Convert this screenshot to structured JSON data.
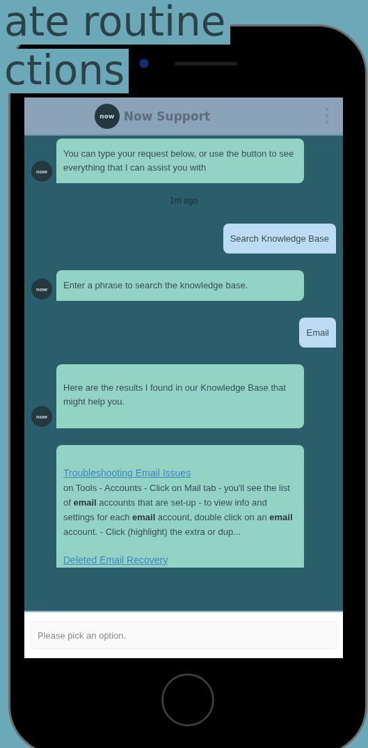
{
  "slide_title": {
    "line_1": "ate routine",
    "line_2": "ctions"
  },
  "header": {
    "logo": "now",
    "title": "Now Support"
  },
  "messages": [
    {
      "kind": "bot",
      "avatar": "now",
      "text": "You can type your request below, or use the button to see everything that I can assist you with"
    },
    {
      "kind": "time",
      "text": "1m ago"
    },
    {
      "kind": "user",
      "text": "Search Knowledge Base"
    },
    {
      "kind": "bot",
      "avatar": "now",
      "text": "Enter a phrase to search the knowledge base."
    },
    {
      "kind": "user",
      "text": "Email"
    },
    {
      "kind": "bot",
      "avatar": "now",
      "text": "Here are the results I found in our Knowledge Base that might help you."
    },
    {
      "kind": "results",
      "results": [
        {
          "title": "Troubleshooting Email Issues",
          "snippet": "on Tools - Accounts - Click on Mail tab - you'll see the list of **email** accounts that are set-up - to view info and settings for each **email** account, double click on an **email** account. - Click (highlight) the extra or dup..."
        },
        {
          "title": "Deleted Email Recovery"
        }
      ]
    }
  ],
  "input": {
    "placeholder": "Please pick an option."
  }
}
